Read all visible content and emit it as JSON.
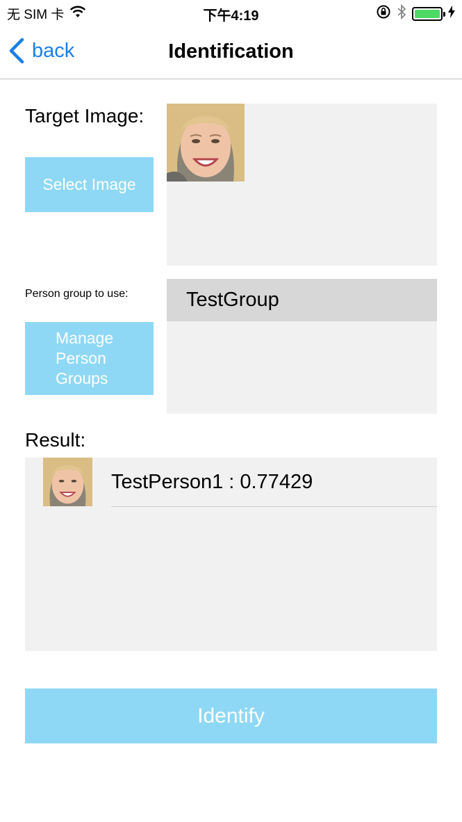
{
  "status_bar": {
    "carrier": "无 SIM 卡",
    "time": "下午4:19",
    "battery_level": 1.0,
    "icons": [
      "wifi-icon",
      "rotation-lock-icon",
      "bluetooth-icon",
      "battery-icon",
      "charging-bolt-icon"
    ]
  },
  "nav": {
    "back_label": "back",
    "title": "Identification",
    "accent_color": "#1a7fe8"
  },
  "target": {
    "label": "Target Image:",
    "select_button": "Select Image"
  },
  "group": {
    "label": "Person group to use:",
    "manage_button": "Manage Person Groups",
    "items": [
      "TestGroup"
    ]
  },
  "result": {
    "label": "Result:",
    "items": [
      {
        "text": "TestPerson1 : 0.77429"
      }
    ]
  },
  "identify_button": "Identify",
  "colors": {
    "button_bg": "#8fd8f5",
    "panel_bg": "#f1f1f1",
    "selected_row_bg": "#d7d7d7"
  }
}
